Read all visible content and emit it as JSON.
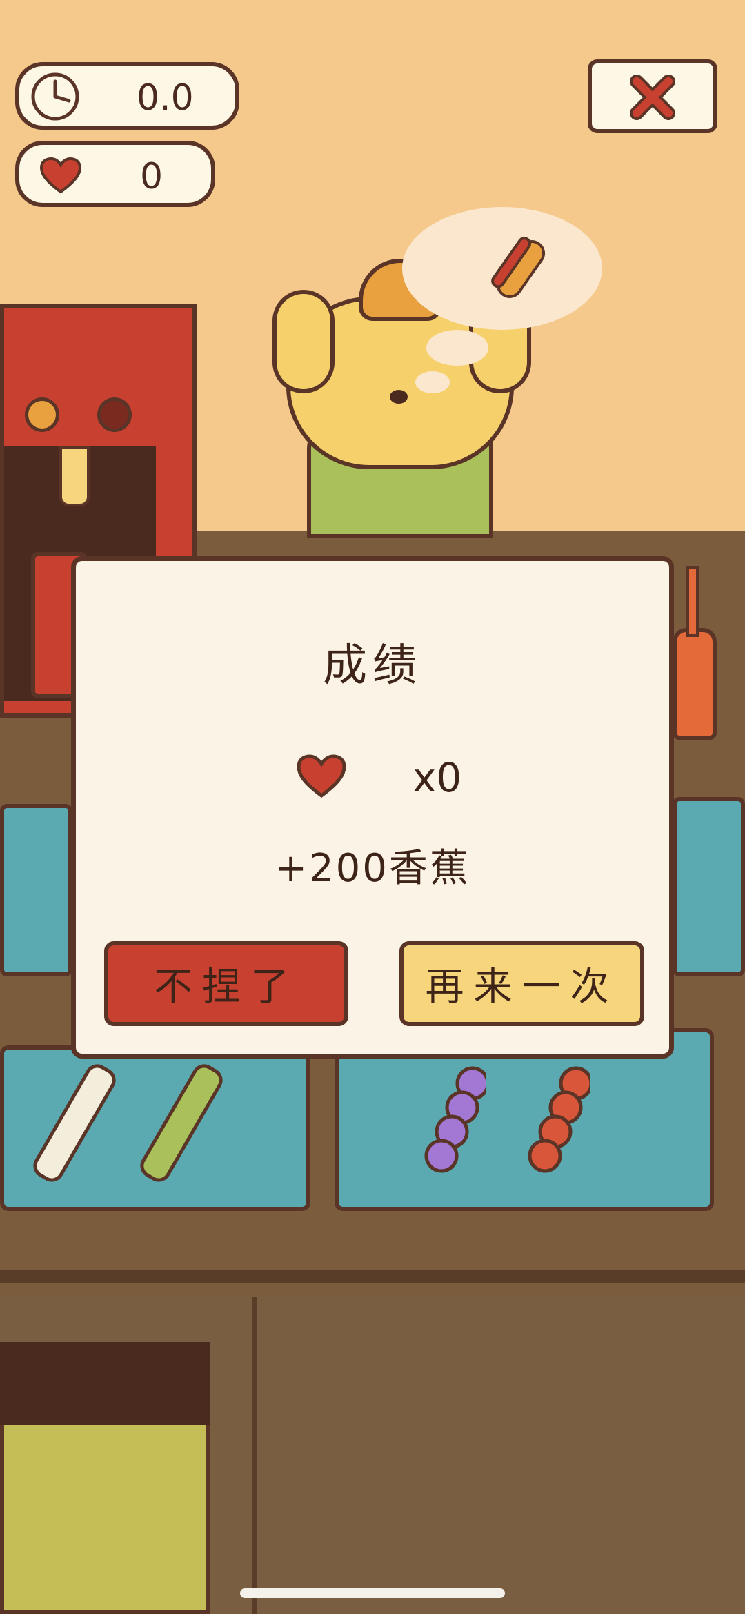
{
  "hud": {
    "timer_icon": "clock-icon",
    "timer_value": "0.0",
    "hearts_icon": "heart-icon",
    "hearts_value": "0",
    "close_icon": "close-x-icon"
  },
  "customer": {
    "order_icon": "hotdog-icon"
  },
  "result_dialog": {
    "title": "成绩",
    "heart_icon": "heart-icon",
    "heart_count": "x0",
    "reward": "+200香蕉",
    "quit_label": "不捏了",
    "retry_label": "再来一次"
  },
  "colors": {
    "background": "#f4c98b",
    "outline": "#5a3426",
    "quit_button": "#c8402f",
    "retry_button": "#f6d57d",
    "dialog_bg": "#fbf4e6",
    "tray": "#5ba9b1"
  }
}
